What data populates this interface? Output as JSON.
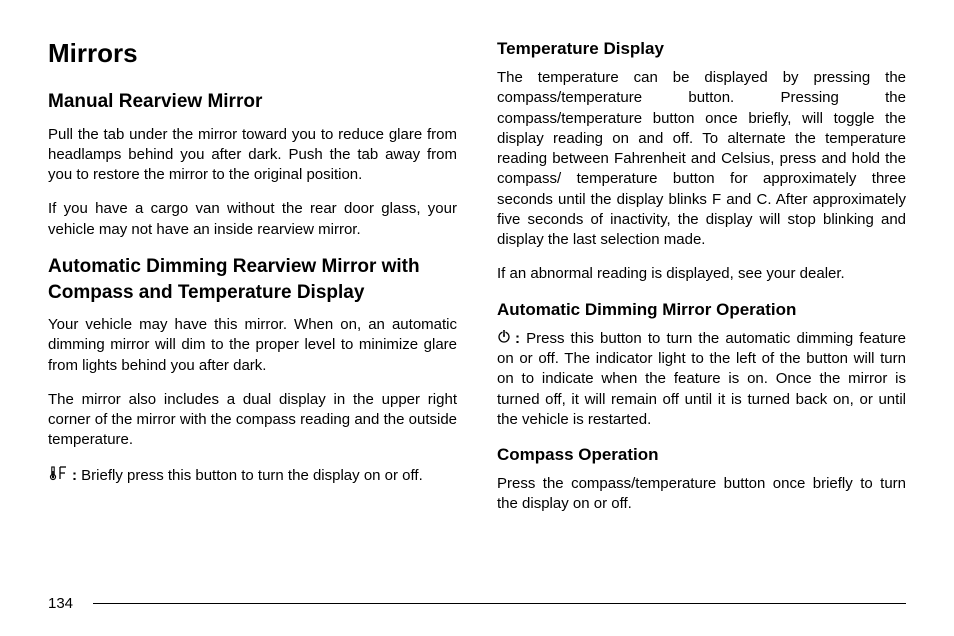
{
  "left": {
    "h1": "Mirrors",
    "h2a": "Manual Rearview Mirror",
    "p1": "Pull the tab under the mirror toward you to reduce glare from headlamps behind you after dark. Push the tab away from you to restore the mirror to the original position.",
    "p2": "If you have a cargo van without the rear door glass, your vehicle may not have an inside rearview mirror.",
    "h2b": "Automatic Dimming Rearview Mirror with Compass and Temperature Display",
    "p3": "Your vehicle may have this mirror. When on, an automatic dimming mirror will dim to the proper level to minimize glare from lights behind you after dark.",
    "p4": "The mirror also includes a dual display in the upper right corner of the mirror with the compass reading and the outside temperature.",
    "icon_text": "Briefly press this button to turn the display on or off."
  },
  "right": {
    "h3a": "Temperature Display",
    "p1": "The temperature can be displayed by pressing the compass/temperature button. Pressing the compass/temperature button once briefly, will toggle the display reading on and off. To alternate the temperature reading between Fahrenheit and Celsius, press and hold the compass/ temperature button for approximately three seconds until the display blinks F and C. After approximately five seconds of inactivity, the display will stop blinking and display the last selection made.",
    "p2": "If an abnormal reading is displayed, see your dealer.",
    "h3b": "Automatic Dimming Mirror Operation",
    "icon_text": "Press this button to turn the automatic dimming feature on or off. The indicator light to the left of the button will turn on to indicate when the feature is on. Once the mirror is turned off, it will remain off until it is turned back on, or until the vehicle is restarted.",
    "h3c": "Compass Operation",
    "p3": "Press the compass/temperature button once briefly to turn the display on or off."
  },
  "page_number": "134"
}
